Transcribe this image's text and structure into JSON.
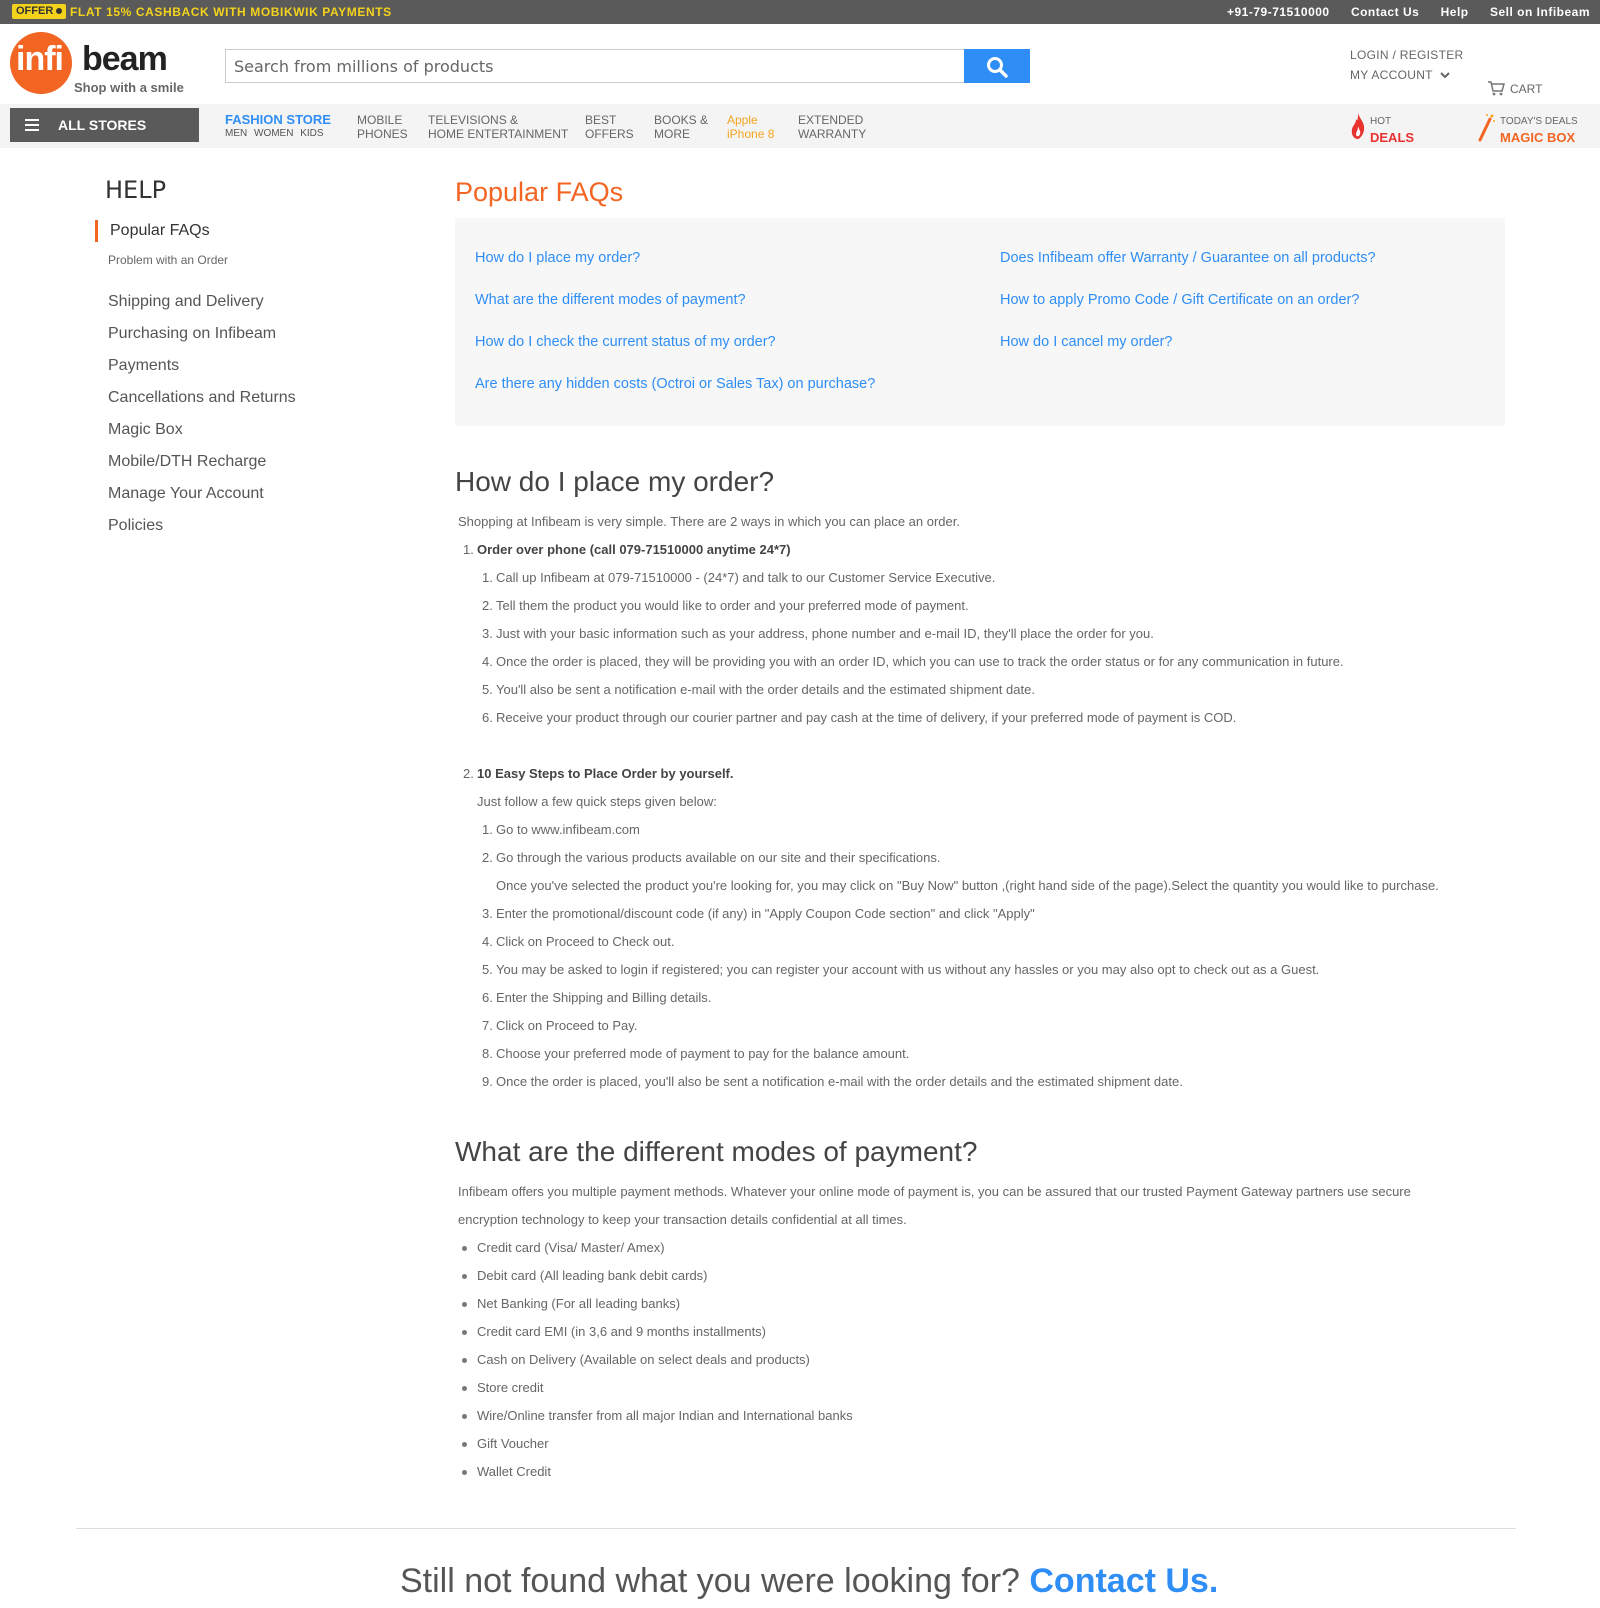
{
  "topbar": {
    "offer_badge": "OFFER",
    "offer_text": "FLAT 15% CASHBACK WITH MOBIKWIK PAYMENTS",
    "phone": "+91-79-71510000",
    "contact": "Contact Us",
    "help": "Help",
    "sell": "Sell on Infibeam"
  },
  "header": {
    "logo_infi": "infi",
    "logo_beam": "beam",
    "logo_tagline": "Shop with a smile",
    "search_placeholder": "Search from millions of products",
    "login_register": "LOGIN / REGISTER",
    "my_account": "MY ACCOUNT",
    "cart": "CART"
  },
  "nav": {
    "all_stores": "ALL STORES",
    "fashion_main": "FASHION STORE",
    "fashion_sub": "MEN WOMEN KIDS",
    "mobile_1": "MOBILE",
    "mobile_2": "PHONES",
    "tv_1": "TELEVISIONS &",
    "tv_2": "HOME ENTERTAINMENT",
    "best_1": "BEST",
    "best_2": "OFFERS",
    "books_1": "BOOKS &",
    "books_2": "MORE",
    "apple_1": "Apple",
    "apple_2": "iPhone 8",
    "warranty_1": "EXTENDED",
    "warranty_2": "WARRANTY",
    "hot_small": "HOT",
    "hot_big": "DEALS",
    "magic_small": "TODAY'S DEALS",
    "magic_big": "MAGIC BOX"
  },
  "sidebar": {
    "title": "HELP",
    "active": "Popular FAQs",
    "active_sub": "Problem with an Order",
    "items": [
      "Shipping and Delivery",
      "Purchasing on Infibeam",
      "Payments",
      "Cancellations and Returns",
      "Magic Box",
      "Mobile/DTH Recharge",
      "Manage Your Account",
      "Policies"
    ]
  },
  "main": {
    "title": "Popular FAQs",
    "faq_left": [
      "How do I place my order?",
      "What are the different modes of payment?",
      "How do I check the current status of my order?",
      "Are there any hidden costs (Octroi or Sales Tax) on purchase?"
    ],
    "faq_right": [
      "Does Infibeam offer Warranty / Guarantee on all products?",
      "How to apply Promo Code / Gift Certificate on an order?",
      "How do I cancel my order?"
    ]
  },
  "section1": {
    "title": "How do I place my order?",
    "intro": "Shopping at Infibeam is very simple. There are 2 ways in which you can place an order.",
    "way1_num": "1.",
    "way1_title": "Order over phone (call 079-71510000 anytime 24*7)",
    "way1_steps": [
      "Call up Infibeam at 079-71510000 - (24*7) and talk to our Customer Service Executive.",
      "Tell them the product you would like to order and your preferred mode of payment.",
      "Just with your basic information such as your address, phone number and e-mail ID, they'll place the order for you.",
      "Once the order is placed, they will be providing you with an order ID, which you can use to track the order status or for any communication in future.",
      "You'll also be sent a notification e-mail with the order details and the estimated shipment date.",
      "Receive your product through our courier partner and pay cash at the time of delivery, if your preferred mode of payment is COD."
    ],
    "way2_num": "2.",
    "way2_title": "10 Easy Steps to Place Order by yourself.",
    "way2_intro": "Just follow a few quick steps given below:",
    "way2_steps": [
      "Go to www.infibeam.com",
      "Go through the various products available on our site and their specifications.",
      "Enter the promotional/discount code (if any) in \"Apply Coupon Code section\" and click \"Apply\"",
      "Click on Proceed to Check out.",
      "You may be asked to login if registered; you can register your account with us without any hassles or you may also opt to check out as a Guest.",
      "Enter the Shipping and Billing details.",
      "Click on Proceed to Pay.",
      "Choose your preferred mode of payment to pay for the balance amount.",
      "Once the order is placed, you'll also be sent a notification e-mail with the order details and the estimated shipment date."
    ],
    "way2_step2_extra": "Once you've selected the product you're looking for, you may click on \"Buy Now\" button ,(right hand side of the page).Select the quantity you would like to purchase."
  },
  "section2": {
    "title": "What are the different modes of payment?",
    "intro_1": "Infibeam offers you multiple payment methods. Whatever your online mode of payment is, you can be assured that our trusted Payment Gateway partners use secure",
    "intro_2": "encryption technology to keep your transaction details confidential at all times.",
    "methods": [
      "Credit card (Visa/ Master/ Amex)",
      "Debit card (All leading bank debit cards)",
      "Net Banking (For all leading banks)",
      "Credit card EMI (in 3,6 and 9 months installments)",
      "Cash on Delivery (Available on select deals and products)",
      "Store credit",
      "Wire/Online transfer from all major Indian and International banks",
      "Gift Voucher",
      "Wallet Credit"
    ]
  },
  "footer": {
    "question": "Still not found what you were looking for?",
    "contact": "Contact Us."
  },
  "colors": {
    "brand_orange": "#f26522",
    "link_blue": "#2f8ef5",
    "offer_yellow": "#f3d21b",
    "topbar_gray": "#5a5a5a"
  }
}
